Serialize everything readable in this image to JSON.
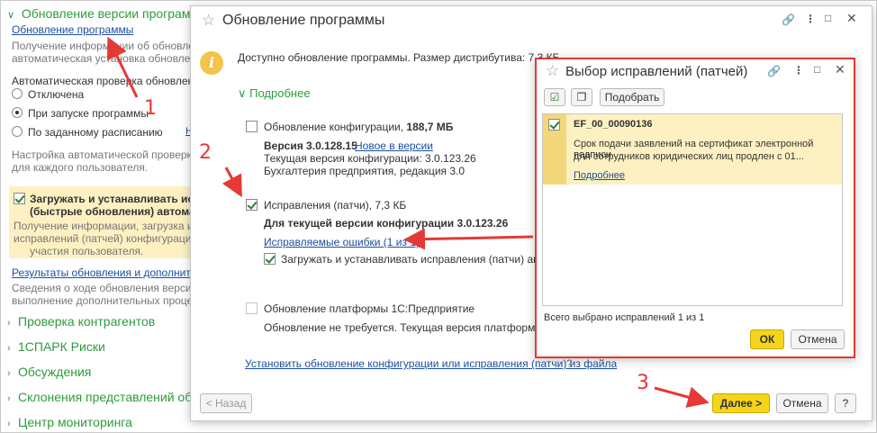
{
  "left_panel": {
    "section_title": "Обновление версии программы",
    "update_link": "Обновление программы",
    "update_desc_1": "Получение информации об обновлениях и",
    "update_desc_2": "автоматическая установка обновлений.",
    "auto_check_label": "Автоматическая проверка обновлений:",
    "radio_options": [
      {
        "label": "Отключена",
        "selected": false
      },
      {
        "label": "При запуске программы",
        "selected": true
      },
      {
        "label": "По заданному расписанию",
        "selected": false
      }
    ],
    "schedule_note": "Н",
    "settings_desc_1": "Настройка автоматической проверки обно",
    "settings_desc_2": "для каждого пользователя.",
    "patch_checkbox_label_1": "Загружать и устанавливать испра",
    "patch_checkbox_label_2": "(быстрые обновления) автоматич",
    "patch_desc_1": "Получение информации, загрузка и устан",
    "patch_desc_2": "исправлений (патчей) конфигурации в \"т",
    "patch_desc_3": "участия пользователя.",
    "results_link": "Результаты обновления и дополнительна",
    "results_desc_1": "Сведения о ходе обновления версии прогр",
    "results_desc_2": "выполнение дополнительных процедур об",
    "sections": [
      "Проверка контрагентов",
      "1СПАРК Риски",
      "Обсуждения",
      "Склонения представлений объек",
      "Центр мониторинга"
    ]
  },
  "main_dialog": {
    "title": "Обновление программы",
    "available_text": "Доступно обновление программы. Размер дистрибутива: 7,3 КБ",
    "details_label": "Подробнее",
    "config_update_label": "Обновление конфигурации, ",
    "config_update_size": "188,7 МБ",
    "version_label": "Версия 3.0.128.15",
    "whats_new_link": "Новое в версии",
    "current_version": "Текущая версия конфигурации: 3.0.123.26",
    "edition": "Бухгалтерия предприятия, редакция 3.0",
    "patches_label": "Исправления (патчи), 7,3 КБ",
    "patches_for_version": "Для текущей версии конфигурации 3.0.123.26",
    "fixed_errors_link": "Исправляемые ошибки (1 из 1)",
    "auto_install_label": "Загружать и устанавливать исправления (патчи) автоматич",
    "platform_update_label": "Обновление платформы 1С:Предприятие",
    "platform_desc": "Обновление не требуется. Текущая версия платформы 1С:Пр",
    "install_from_file_link": "Установить обновление конфигурации или исправления (патчи) из файла",
    "help_mark": "?",
    "back_button": "< Назад",
    "next_button": "Далее >",
    "cancel_button": "Отмена",
    "help_button": "?"
  },
  "patch_dialog": {
    "title": "Выбор исправлений (патчей)",
    "select_button": "Подобрать",
    "patch_id": "EF_00_00090136",
    "patch_desc_1": "Срок подачи заявлений на сертификат электронной подписи",
    "patch_desc_2": "для сотрудников юридических лиц продлен с 01...",
    "details_link": "Подробнее",
    "total_selected": "Всего выбрано исправлений 1 из 1",
    "ok_button": "ОК",
    "cancel_button": "Отмена"
  },
  "annotations": {
    "label_1": "1",
    "label_2": "2",
    "label_3": "3"
  },
  "colors": {
    "accent_green": "#2e9b3e",
    "link_blue": "#1b4fa0",
    "annotation_red": "#e53935",
    "highlight_yellow": "#fdf1c2",
    "button_yellow": "#f5d41a"
  }
}
